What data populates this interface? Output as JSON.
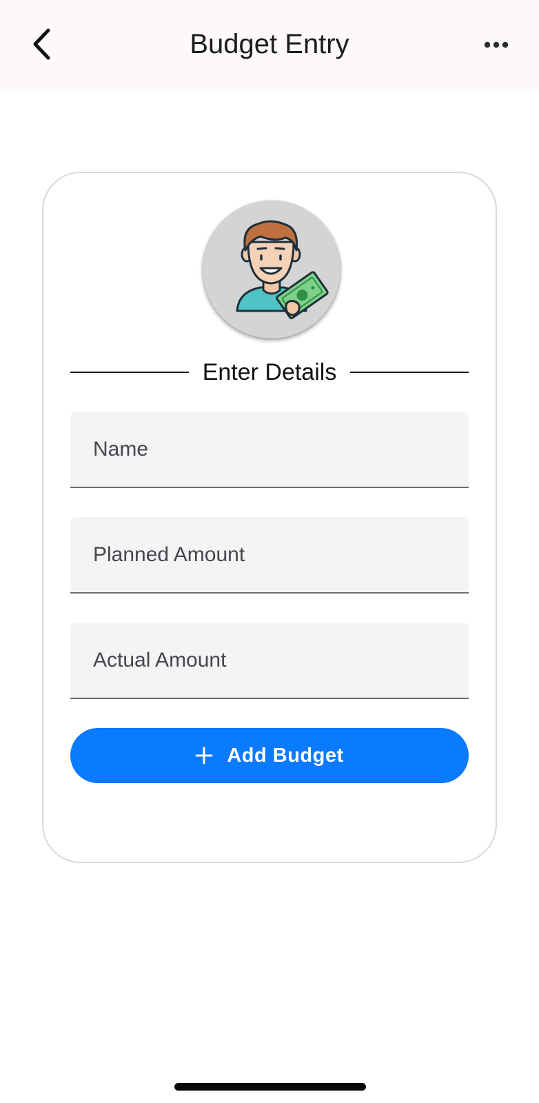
{
  "header": {
    "title": "Budget Entry",
    "back_icon": "chevron-left-icon",
    "more_icon": "ellipsis-horizontal-icon"
  },
  "card": {
    "avatar_icon": "person-holding-money-icon",
    "section_title": "Enter Details",
    "fields": {
      "name": {
        "placeholder": "Name",
        "value": ""
      },
      "planned_amount": {
        "placeholder": "Planned Amount",
        "value": ""
      },
      "actual_amount": {
        "placeholder": "Actual Amount",
        "value": ""
      }
    },
    "add_button": {
      "label": "Add Budget",
      "icon": "plus-icon"
    }
  },
  "colors": {
    "header_bg": "#fdf8fc",
    "accent": "#0a7aff",
    "field_bg": "#f4f4f4",
    "card_border": "#d9d9d9"
  }
}
